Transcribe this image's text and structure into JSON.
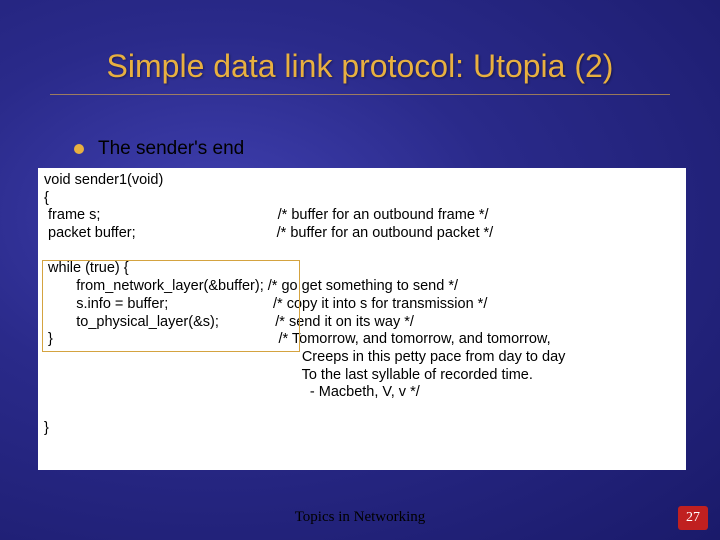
{
  "title": "Simple data link protocol: Utopia (2)",
  "bullet": "The sender's end",
  "code_lines": [
    "void sender1(void)",
    "{",
    " frame s;                                            /* buffer for an outbound frame */",
    " packet buffer;                                   /* buffer for an outbound packet */",
    "",
    " while (true) {",
    "        from_network_layer(&buffer); /* go get something to send */",
    "        s.info = buffer;                          /* copy it into s for transmission */",
    "        to_physical_layer(&s);              /* send it on its way */",
    " }                                                        /* Tomorrow, and tomorrow, and tomorrow,",
    "                                                                Creeps in this petty pace from day to day",
    "                                                                To the last syllable of recorded time.",
    "                                                                  - Macbeth, V, v */",
    "",
    "}"
  ],
  "footer": "Topics in Networking",
  "page_number": "27"
}
